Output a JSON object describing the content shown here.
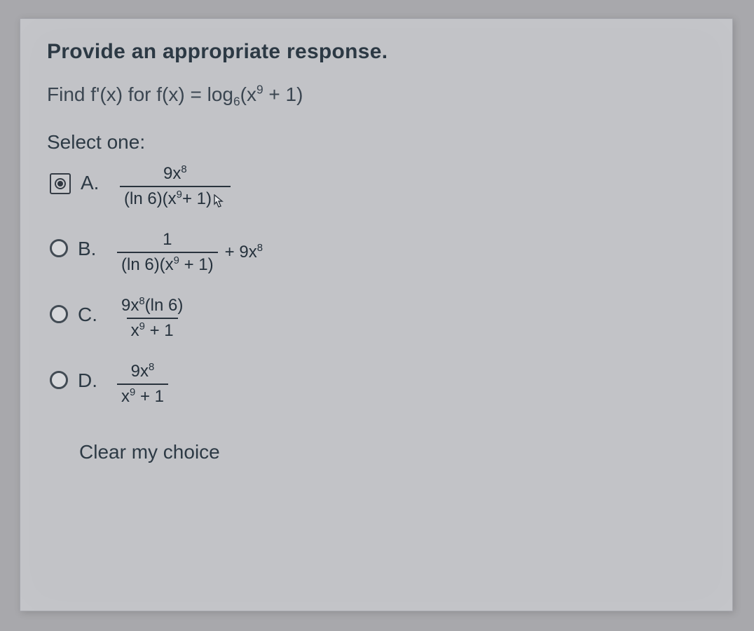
{
  "prompt": "Provide an appropriate response.",
  "stem": {
    "prefix": "Find f'(x) for f(x) = log",
    "log_base": "6",
    "inner_a": "(x",
    "inner_exp": "9",
    "inner_b": " + 1)"
  },
  "select_one": "Select one:",
  "choices": {
    "a": {
      "letter": "A.",
      "num_a": "9x",
      "num_exp": "8",
      "den_a": "(ln 6)(x",
      "den_exp": "9",
      "den_b": "+ 1)"
    },
    "b": {
      "letter": "B.",
      "num": "1",
      "den_a": "(ln 6)(x",
      "den_exp": "9",
      "den_b": " + 1)",
      "extra_a": " + 9x",
      "extra_exp": "8"
    },
    "c": {
      "letter": "C.",
      "num_a": "9x",
      "num_exp": "8",
      "num_b": "(ln 6)",
      "den_a": "x",
      "den_exp": "9",
      "den_b": " + 1"
    },
    "d": {
      "letter": "D.",
      "num_a": "9x",
      "num_exp": "8",
      "den_a": "x",
      "den_exp": "9",
      "den_b": " + 1"
    }
  },
  "clear": "Clear my choice"
}
